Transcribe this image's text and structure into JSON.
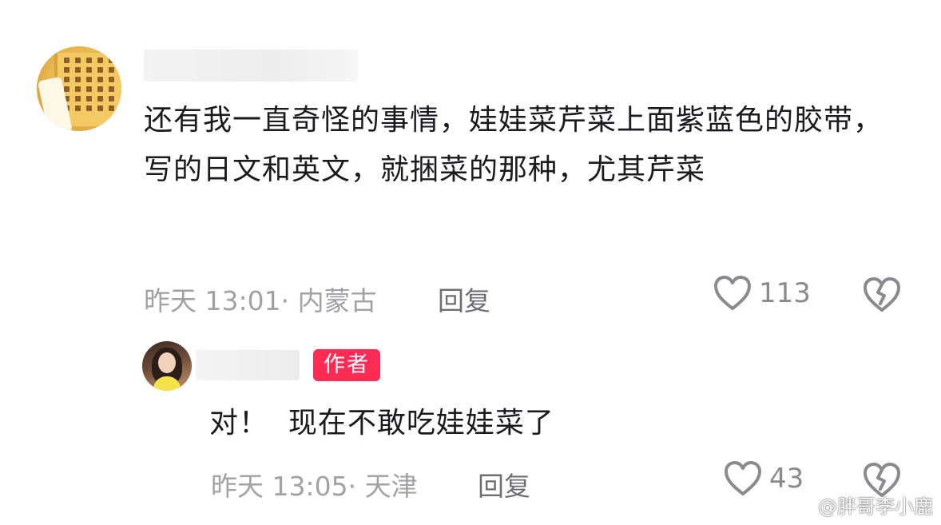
{
  "comment": {
    "text": "还有我一直奇怪的事情，娃娃菜芹菜上面紫蓝色的胶带，写的日文和英文，就捆菜的那种，尤其芹菜",
    "time_location": "昨天 13:01· 内蒙古",
    "reply_label": "回复",
    "likes": "113",
    "icons": {
      "like": "heart-outline-icon",
      "dislike": "broken-heart-icon"
    }
  },
  "reply": {
    "badge": "作者",
    "text": "对！  现在不敢吃娃娃菜了",
    "time_location": "昨天 13:05· 天津",
    "reply_label": "回复",
    "likes": "43",
    "icons": {
      "like": "heart-outline-icon",
      "dislike": "broken-heart-icon"
    }
  },
  "watermark": {
    "text": "@胖哥李小鹿"
  },
  "colors": {
    "badge": "#fe2c55",
    "meta": "#a1a1a6",
    "icon": "#8a8a8f"
  }
}
